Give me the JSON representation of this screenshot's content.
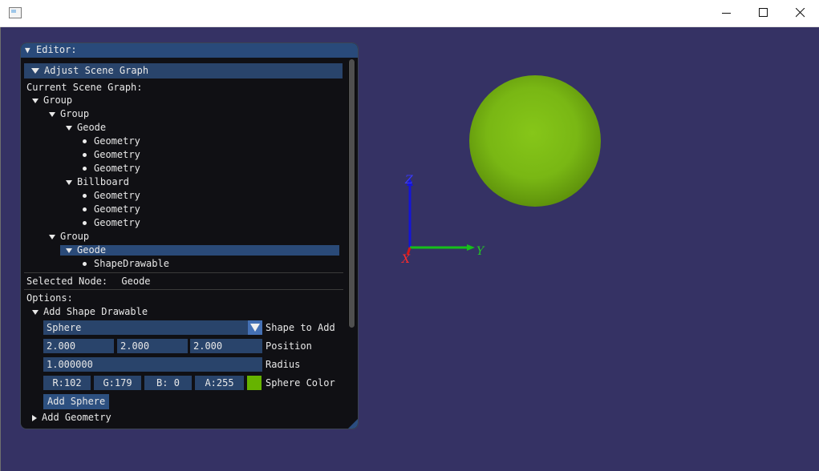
{
  "window": {
    "controls": {
      "minimize_icon": "minimize-icon",
      "maximize_icon": "maximize-icon",
      "close_icon": "close-icon"
    }
  },
  "scene": {
    "background_color": "#353264",
    "sphere_color": "#66b300",
    "axes": {
      "z_label": "Z",
      "y_label": "Y",
      "x_label": "X",
      "z_color": "#1515d8",
      "y_color": "#16c01a",
      "x_color": "#d41818"
    }
  },
  "editor": {
    "title": "Editor:",
    "adjust_header": "Adjust Scene Graph",
    "current_label": "Current Scene Graph:",
    "tree": [
      {
        "label": "Group",
        "type": "branch"
      },
      {
        "label": "Group",
        "type": "branch"
      },
      {
        "label": "Geode",
        "type": "branch"
      },
      {
        "label": "Geometry",
        "type": "leaf"
      },
      {
        "label": "Geometry",
        "type": "leaf"
      },
      {
        "label": "Geometry",
        "type": "leaf"
      },
      {
        "label": "Billboard",
        "type": "branch"
      },
      {
        "label": "Geometry",
        "type": "leaf"
      },
      {
        "label": "Geometry",
        "type": "leaf"
      },
      {
        "label": "Geometry",
        "type": "leaf"
      },
      {
        "label": "Group",
        "type": "branch"
      },
      {
        "label": "Geode",
        "type": "branch",
        "selected": true
      },
      {
        "label": "ShapeDrawable",
        "type": "leaf"
      }
    ],
    "selected_label": "Selected Node:",
    "selected_value": "Geode",
    "options_label": "Options:",
    "add_shape_header": "Add Shape Drawable",
    "shape_value": "Sphere",
    "shape_label": "Shape to Add",
    "position": [
      "2.000",
      "2.000",
      "2.000"
    ],
    "position_label": "Position",
    "radius_value": "1.000000",
    "radius_label": "Radius",
    "color": {
      "r": "R:102",
      "g": "G:179",
      "b": "B:  0",
      "a": "A:255",
      "swatch": "#66b300"
    },
    "color_label": "Sphere Color",
    "add_button": "Add Sphere",
    "add_geometry_header": "Add Geometry",
    "theme": {
      "title_bg": "#294a7a",
      "panel_bg": "#101012",
      "field_bg": "#29446b",
      "accent": "#4470b4"
    }
  }
}
